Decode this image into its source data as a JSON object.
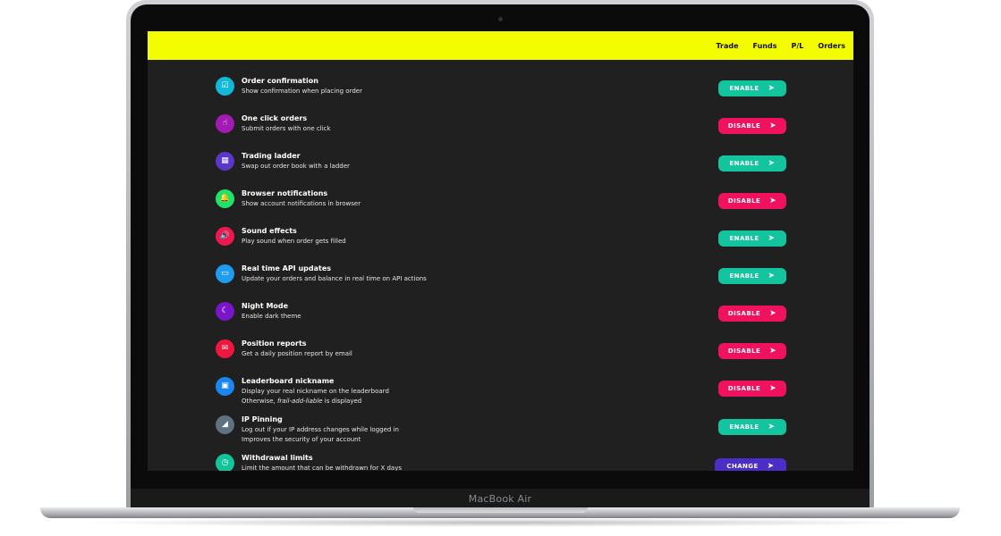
{
  "device": {
    "label": "MacBook Air"
  },
  "nav": {
    "items": [
      "Trade",
      "Funds",
      "P/L",
      "Orders"
    ]
  },
  "colors": {
    "topbar": "#f3fd00",
    "background": "#202020",
    "enable": "#13c59f",
    "disable": "#f0125e",
    "change": "#4b2ec8"
  },
  "settings": [
    {
      "title": "Order confirmation",
      "desc": "Show confirmation when placing order",
      "icon": "checkbox-icon",
      "glyph": "☑",
      "icon_color": "#12b8d8",
      "action": "ENABLE",
      "state": "enable"
    },
    {
      "title": "One click orders",
      "desc": "Submit orders with one click",
      "icon": "pointer-icon",
      "glyph": "☝",
      "icon_color": "#a21ab1",
      "action": "DISABLE",
      "state": "disable"
    },
    {
      "title": "Trading ladder",
      "desc": "Swap out order book with a ladder",
      "icon": "grid-icon",
      "glyph": "▦",
      "icon_color": "#5a36c9",
      "action": "ENABLE",
      "state": "enable"
    },
    {
      "title": "Browser notifications",
      "desc": "Show account notifications in browser",
      "icon": "bell-icon",
      "glyph": "🔔",
      "icon_color": "#20e36a",
      "action": "DISABLE",
      "state": "disable"
    },
    {
      "title": "Sound effects",
      "desc": "Play sound when order gets filled",
      "icon": "speaker-icon",
      "glyph": "🔊",
      "icon_color": "#f0164e",
      "action": "ENABLE",
      "state": "enable"
    },
    {
      "title": "Real time API updates",
      "desc": "Update your orders and balance in real time on API actions",
      "icon": "chat-icon",
      "glyph": "▭",
      "icon_color": "#1f9bf0",
      "action": "ENABLE",
      "state": "enable"
    },
    {
      "title": "Night Mode",
      "desc": "Enable dark theme",
      "icon": "moon-icon",
      "glyph": "☾",
      "icon_color": "#7a16c8",
      "action": "DISABLE",
      "state": "disable"
    },
    {
      "title": "Position reports",
      "desc": "Get a daily position report by email",
      "icon": "mail-icon",
      "glyph": "✉",
      "icon_color": "#f0163e",
      "action": "DISABLE",
      "state": "disable"
    },
    {
      "title": "Leaderboard nickname",
      "desc": "Display your real nickname on the leaderboard",
      "desc2_prefix": "Otherwise, ",
      "desc2_nick": "frail-add-liable",
      "desc2_suffix": " is displayed",
      "icon": "badge-icon",
      "glyph": "▣",
      "icon_color": "#1b86f0",
      "action": "DISABLE",
      "state": "disable"
    },
    {
      "title": "IP Pinning",
      "desc": "Log out if your IP address changes while logged in",
      "desc2": "Improves the security of your account",
      "icon": "signal-icon",
      "glyph": "◢",
      "icon_color": "#5f7280",
      "action": "ENABLE",
      "state": "enable"
    },
    {
      "title": "Withdrawal limits",
      "desc": "Limit the amount that can be withdrawn for X days",
      "icon": "clock-icon",
      "glyph": "◷",
      "icon_color": "#12c49a",
      "action": "CHANGE",
      "state": "change"
    }
  ]
}
